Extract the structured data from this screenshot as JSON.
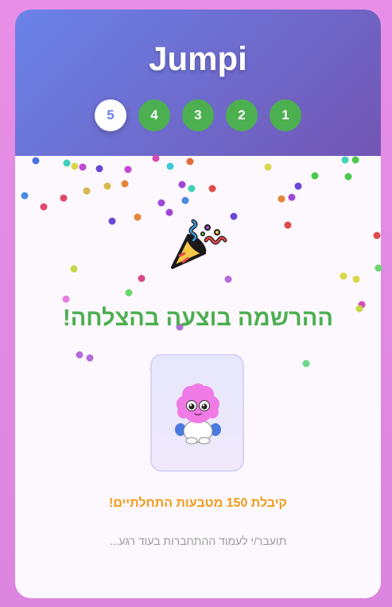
{
  "header": {
    "title": "Jumpi",
    "steps": [
      "5",
      "4",
      "3",
      "2",
      "1"
    ]
  },
  "main": {
    "success_message": "ההרשמה בוצעה בהצלחה!",
    "coins_message": "קיבלת 150 מטבעות התחלתיים!",
    "redirect_message": "תועבר/י לעמוד ההתחברות בעוד רגע..."
  },
  "icons": {
    "celebration": "party-popper-icon",
    "avatar": "pink-fluffy-monster-avatar"
  },
  "colors": {
    "header_gradient_start": "#6a82e8",
    "header_gradient_end": "#7256b4",
    "step_done": "#4caf50",
    "success_text": "#4caf50",
    "coins_text": "#f09a1b",
    "page_background": "#e88ee6"
  }
}
